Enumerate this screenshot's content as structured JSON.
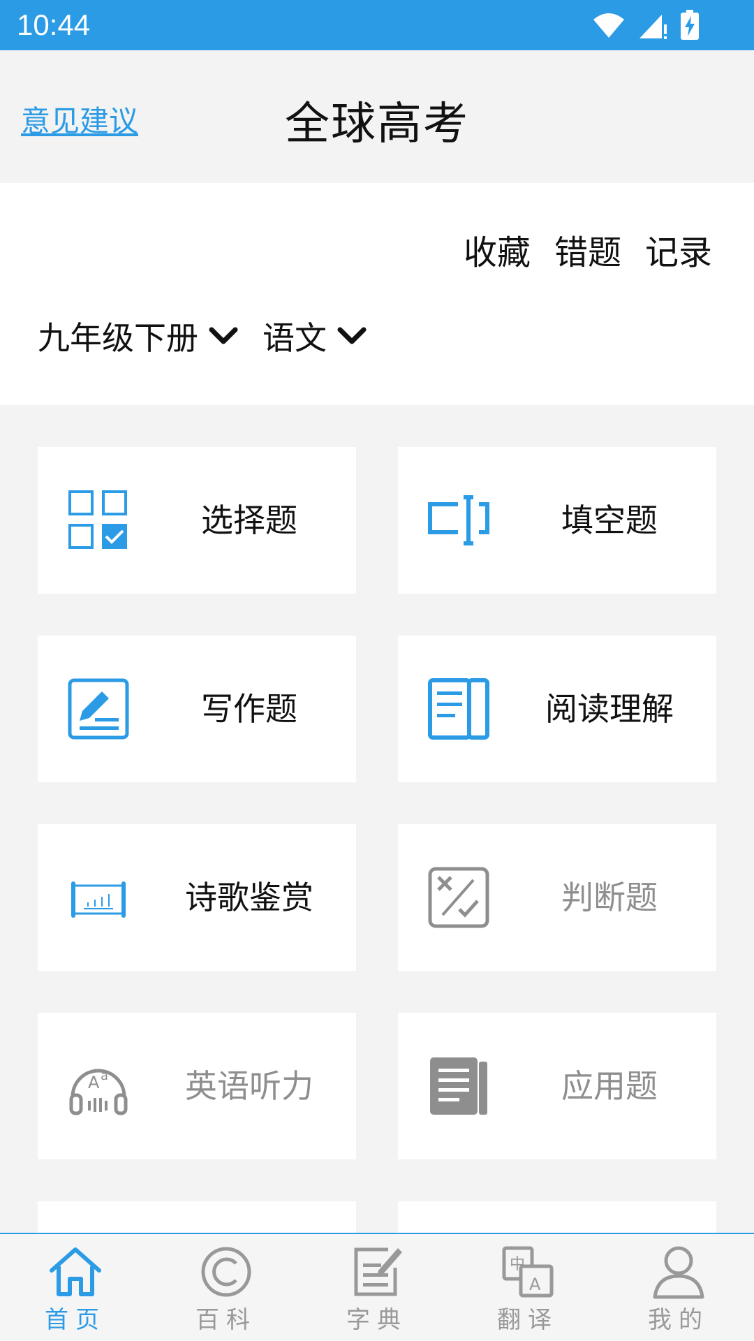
{
  "status_bar": {
    "time": "10:44"
  },
  "header": {
    "feedback_link": "意见建议",
    "title": "全球高考"
  },
  "quick_links": [
    "收藏",
    "错题",
    "记录"
  ],
  "selectors": {
    "grade": "九年级下册",
    "subject": "语文"
  },
  "cards": [
    {
      "label": "选择题",
      "icon": "multiple-choice-icon",
      "enabled": true
    },
    {
      "label": "填空题",
      "icon": "fill-blank-icon",
      "enabled": true
    },
    {
      "label": "写作题",
      "icon": "writing-icon",
      "enabled": true
    },
    {
      "label": "阅读理解",
      "icon": "reading-icon",
      "enabled": true
    },
    {
      "label": "诗歌鉴赏",
      "icon": "scroll-icon",
      "enabled": true
    },
    {
      "label": "判断题",
      "icon": "true-false-icon",
      "enabled": false
    },
    {
      "label": "英语听力",
      "icon": "headphones-icon",
      "enabled": false
    },
    {
      "label": "应用题",
      "icon": "document-icon",
      "enabled": false
    }
  ],
  "tabs": [
    {
      "label": "首页",
      "icon": "home-icon",
      "active": true
    },
    {
      "label": "百科",
      "icon": "copyright-icon",
      "active": false
    },
    {
      "label": "字典",
      "icon": "dictionary-icon",
      "active": false
    },
    {
      "label": "翻译",
      "icon": "translate-icon",
      "active": false
    },
    {
      "label": "我的",
      "icon": "user-icon",
      "active": false
    }
  ],
  "colors": {
    "accent": "#2b9be6",
    "disabled": "#8e8e8e",
    "background": "#f3f3f3"
  }
}
